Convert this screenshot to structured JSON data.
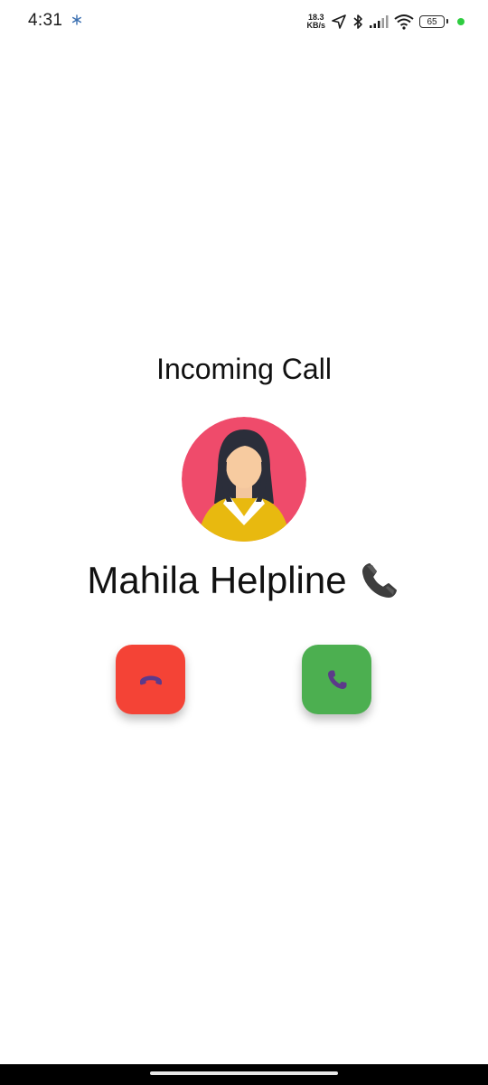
{
  "status_bar": {
    "time": "4:31",
    "net_speed_value": "18.3",
    "net_speed_unit": "KB/s",
    "battery_level": "65",
    "icons": [
      "snowflake-icon",
      "location-arrow-icon",
      "bluetooth-icon",
      "signal-icon",
      "wifi-icon",
      "battery-icon"
    ]
  },
  "call": {
    "title": "Incoming Call",
    "caller_name": "Mahila Helpline",
    "caller_icon": "telephone-receiver-icon",
    "avatar_icon": "woman-avatar-icon"
  },
  "actions": {
    "decline_icon": "hang-up-icon",
    "accept_icon": "phone-icon"
  },
  "colors": {
    "decline": "#f44336",
    "accept": "#4caf50",
    "avatar_bg": "#ef4b6b",
    "button_icon": "#5c3a8a"
  }
}
